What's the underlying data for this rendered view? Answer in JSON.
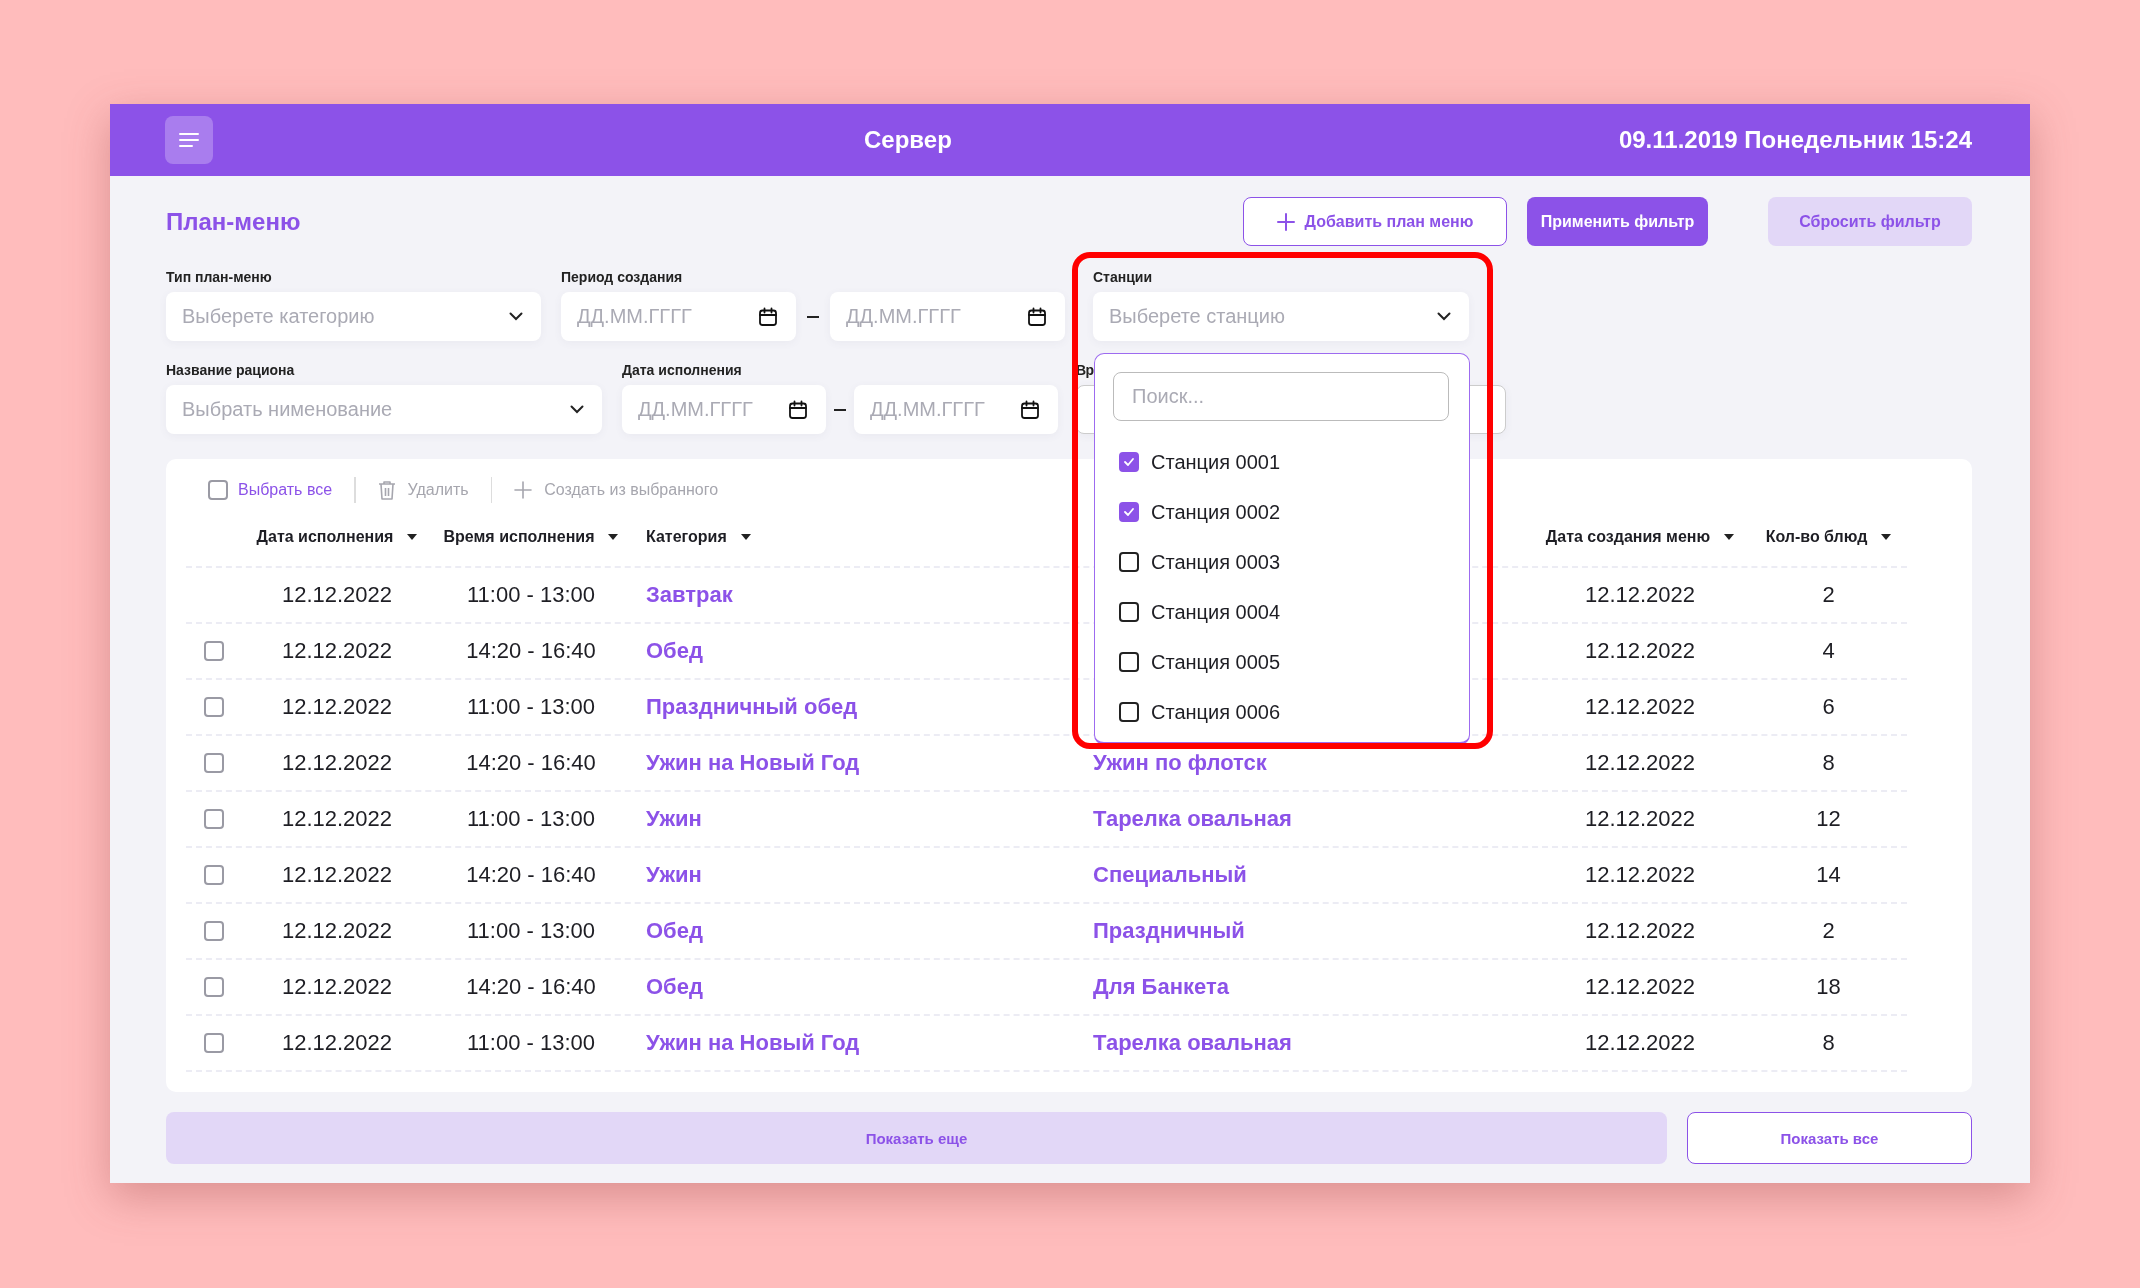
{
  "header": {
    "title": "Сервер",
    "datetime": "09.11.2019 Понедельник 15:24"
  },
  "page_title": "План-меню",
  "actions": [
    {
      "label": "Добавить план меню",
      "kind": "outline"
    },
    {
      "label": "Применить фильтр",
      "kind": "primary"
    },
    {
      "label": "Сбросить фильтр",
      "kind": "secondary"
    }
  ],
  "filters": {
    "menu_type": {
      "label": "Тип план-меню",
      "placeholder": "Выберете категорию"
    },
    "created_period": {
      "label": "Период создания",
      "from_placeholder": "ДД.ММ.ГГГГ",
      "to_placeholder": "ДД.ММ.ГГГГ"
    },
    "stations": {
      "label": "Станции",
      "placeholder": "Выберете станцию",
      "highlighted": true,
      "search_placeholder": "Поиск...",
      "items": [
        {
          "label": "Станция 0001",
          "checked": true
        },
        {
          "label": "Станция 0002",
          "checked": true
        },
        {
          "label": "Станция 0003",
          "checked": false
        },
        {
          "label": "Станция 0004",
          "checked": false
        },
        {
          "label": "Станция 0005",
          "checked": false
        },
        {
          "label": "Станция 0006",
          "checked": false
        }
      ]
    },
    "ration_name": {
      "label": "Название рациона",
      "placeholder": "Выбрать нименование"
    },
    "execution_date": {
      "label": "Дата исполнения",
      "from_placeholder": "ДД.ММ.ГГГГ",
      "to_placeholder": "ДД.ММ.ГГГГ"
    },
    "filter_6": {
      "label": "Вр"
    }
  },
  "table": {
    "toolbar": {
      "select_all": {
        "label": "Выбрать все",
        "checked": false
      },
      "delete": {
        "label": "Удалить",
        "disabled": true
      },
      "create": {
        "label": "Создать из выбранного",
        "disabled": true
      }
    },
    "columns": {
      "exec_date": "Дата исполнения",
      "exec_time": "Время исполнения",
      "category": "Категория",
      "created_date": "Дата создания меню",
      "dish_count": "Кол-во блюд"
    },
    "rows": [
      {
        "selectable": false,
        "exec_date": "12.12.2022",
        "exec_time": "11:00 - 13:00",
        "category": "Завтрак",
        "created_date": "12.12.2022",
        "dish_count": "2"
      },
      {
        "selectable": true,
        "checked": false,
        "exec_date": "12.12.2022",
        "exec_time": "14:20 - 16:40",
        "category": "Обед",
        "created_date": "12.12.2022",
        "dish_count": "4"
      },
      {
        "selectable": true,
        "checked": false,
        "exec_date": "12.12.2022",
        "exec_time": "11:00 - 13:00",
        "category": "Праздничный обед",
        "created_date": "12.12.2022",
        "dish_count": "6"
      },
      {
        "selectable": true,
        "checked": false,
        "exec_date": "12.12.2022",
        "exec_time": "14:20 - 16:40",
        "category": "Ужин на Новый Год",
        "column_4": "Ужин по флотск",
        "created_date": "12.12.2022",
        "dish_count": "8"
      },
      {
        "selectable": true,
        "checked": false,
        "exec_date": "12.12.2022",
        "exec_time": "11:00 - 13:00",
        "category": "Ужин",
        "column_4": "Тарелка овальная",
        "created_date": "12.12.2022",
        "dish_count": "12"
      },
      {
        "selectable": true,
        "checked": false,
        "exec_date": "12.12.2022",
        "exec_time": "14:20 - 16:40",
        "category": "Ужин",
        "column_4": "Специальный",
        "created_date": "12.12.2022",
        "dish_count": "14"
      },
      {
        "selectable": true,
        "checked": false,
        "exec_date": "12.12.2022",
        "exec_time": "11:00 - 13:00",
        "category": "Обед",
        "column_4": "Праздничный",
        "created_date": "12.12.2022",
        "dish_count": "2"
      },
      {
        "selectable": true,
        "checked": false,
        "exec_date": "12.12.2022",
        "exec_time": "14:20 - 16:40",
        "category": "Обед",
        "column_4": "Для Банкета",
        "created_date": "12.12.2022",
        "dish_count": "18"
      },
      {
        "selectable": true,
        "checked": false,
        "exec_date": "12.12.2022",
        "exec_time": "11:00 - 13:00",
        "category": "Ужин на Новый Год",
        "column_4": "Тарелка овальная",
        "created_date": "12.12.2022",
        "dish_count": "8"
      }
    ]
  },
  "footer": {
    "show_more": "Показать еще",
    "show_all": "Показать все"
  }
}
